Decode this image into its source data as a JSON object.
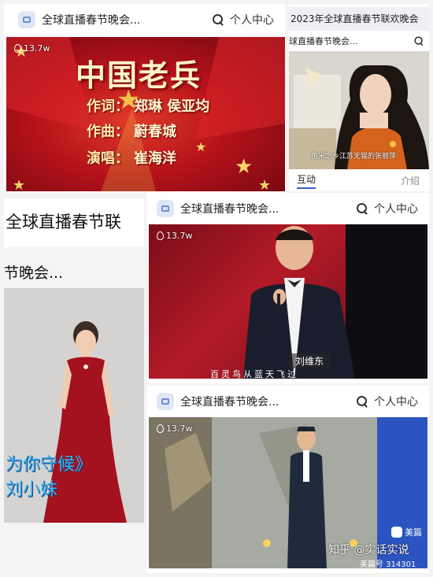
{
  "panel1": {
    "header_title": "全球直播春节晚会...",
    "profile_label": "个人中心",
    "views": "13.7w",
    "song_title": "中国老兵",
    "credits": [
      {
        "role": "作词：",
        "name": "郑琳  侯亚均"
      },
      {
        "role": "作曲：",
        "name": "蔚春城"
      },
      {
        "role": "演唱：",
        "name": "崔海洋"
      }
    ]
  },
  "panel2": {
    "top_title": "2023年全球直播春节联欢晚会",
    "sub_title": "球直播春节晚会...",
    "caption": "鱼米之乡江苏无锡的张丽萍",
    "tab_active": "互动",
    "tab_other": "介绍"
  },
  "panel3": {
    "title_line1": "全球直播春节联",
    "title_line2": "节晚会...",
    "song_overlay": "为你守候》",
    "singer_overlay": "刘小妹"
  },
  "panel4": {
    "header_title": "全球直播春节晚会...",
    "profile_label": "个人中心",
    "views": "13.7w",
    "name_caption": "刘维东",
    "bottom_caption": "百灵鸟从蓝天飞过"
  },
  "panel5": {
    "header_title": "全球直播春节晚会...",
    "profile_label": "个人中心",
    "views": "13.7w",
    "brand": "美篇",
    "watermark": "知乎 @实话实说",
    "code": "美篇号 314301"
  },
  "colors": {
    "stage_red": "#c0121c",
    "gold": "#f6d36b",
    "accent_blue": "#2d5fd0"
  }
}
